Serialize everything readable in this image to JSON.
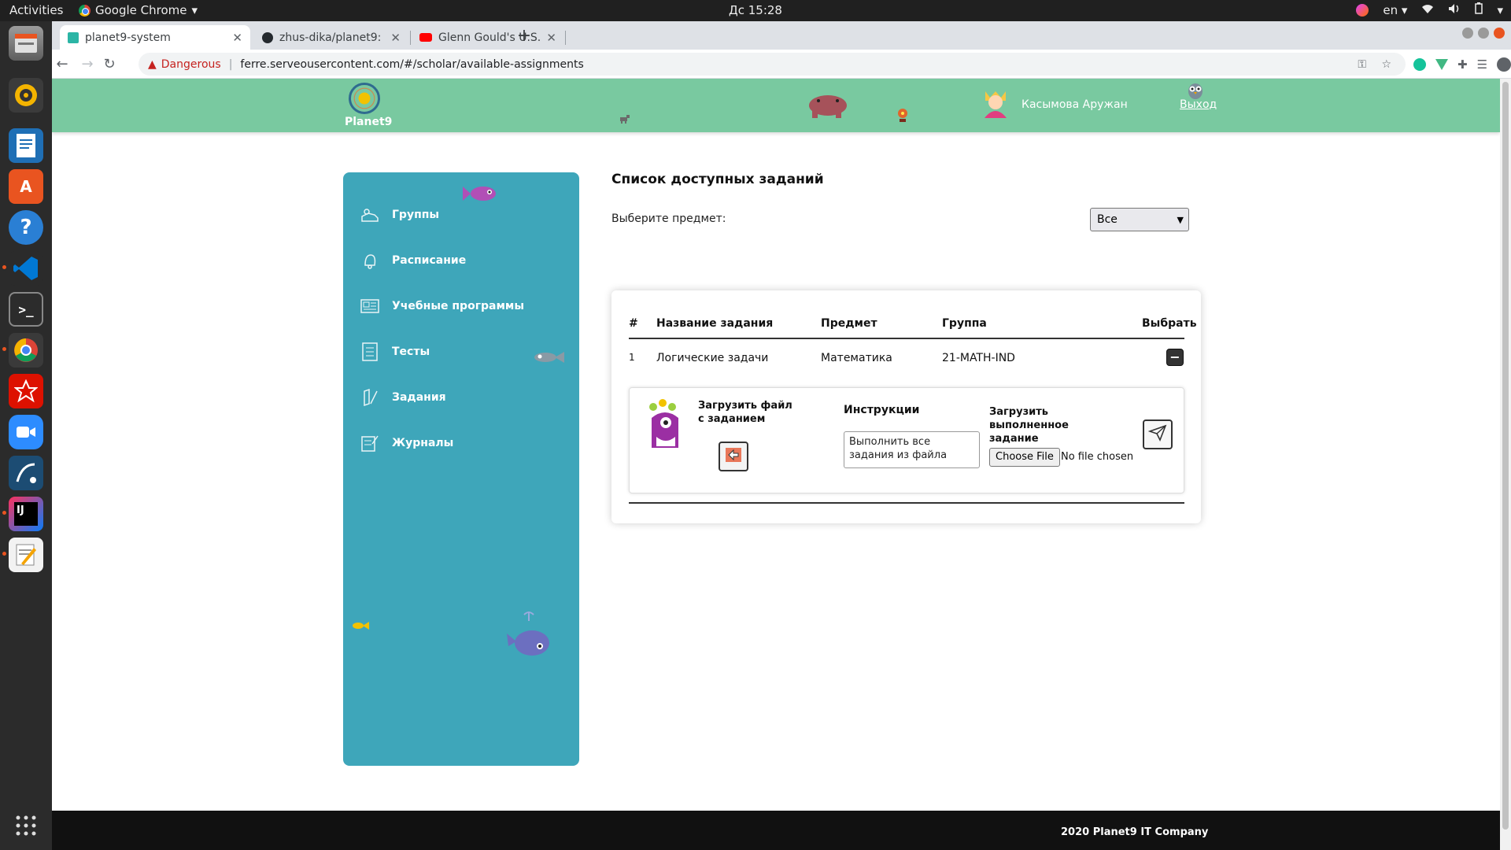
{
  "os": {
    "activities": "Activities",
    "app_name": "Google Chrome",
    "clock": "Дс 15:28",
    "lang": "en"
  },
  "browser": {
    "tabs": [
      {
        "title": "planet9-system"
      },
      {
        "title": "zhus-dika/planet9: educa"
      },
      {
        "title": "Glenn Gould's U.S. Tele"
      }
    ],
    "security_label": "Dangerous",
    "url": "ferre.serveousercontent.com/#/scholar/available-assignments"
  },
  "header": {
    "logo_text": "Planet9",
    "user_name": "Касымова Аружан",
    "logout": "Выход"
  },
  "sidebar": {
    "items": [
      {
        "label": "Группы",
        "icon": "users-icon"
      },
      {
        "label": "Расписание",
        "icon": "bell-icon"
      },
      {
        "label": "Учебные программы",
        "icon": "newspaper-icon"
      },
      {
        "label": "Тесты",
        "icon": "checklist-icon"
      },
      {
        "label": "Задания",
        "icon": "pencil-icon"
      },
      {
        "label": "Журналы",
        "icon": "journal-icon"
      }
    ]
  },
  "main": {
    "title": "Список доступных заданий",
    "subject_label": "Выберите предмет:",
    "subject_selected": "Все",
    "table": {
      "headers": [
        "#",
        "Название задания",
        "Предмет",
        "Группа",
        "Выбрать"
      ],
      "rows": [
        {
          "num": "1",
          "name": "Логические задачи",
          "subject": "Математика",
          "group": "21-MATH-IND",
          "action": "−"
        }
      ]
    },
    "detail": {
      "download_label": "Загрузить файл с заданием",
      "instructions_label": "Инструкции",
      "instructions_text": "Выполнить все задания из файла",
      "upload_label": "Загрузить выполненное задание",
      "choose_file": "Choose File",
      "no_file": "No file chosen"
    }
  },
  "footer": {
    "text": "2020 Planet9 IT Company"
  },
  "colors": {
    "header_green": "#79c9a0",
    "sidebar_teal": "#3ea6ba",
    "footer_dark": "#111111"
  }
}
